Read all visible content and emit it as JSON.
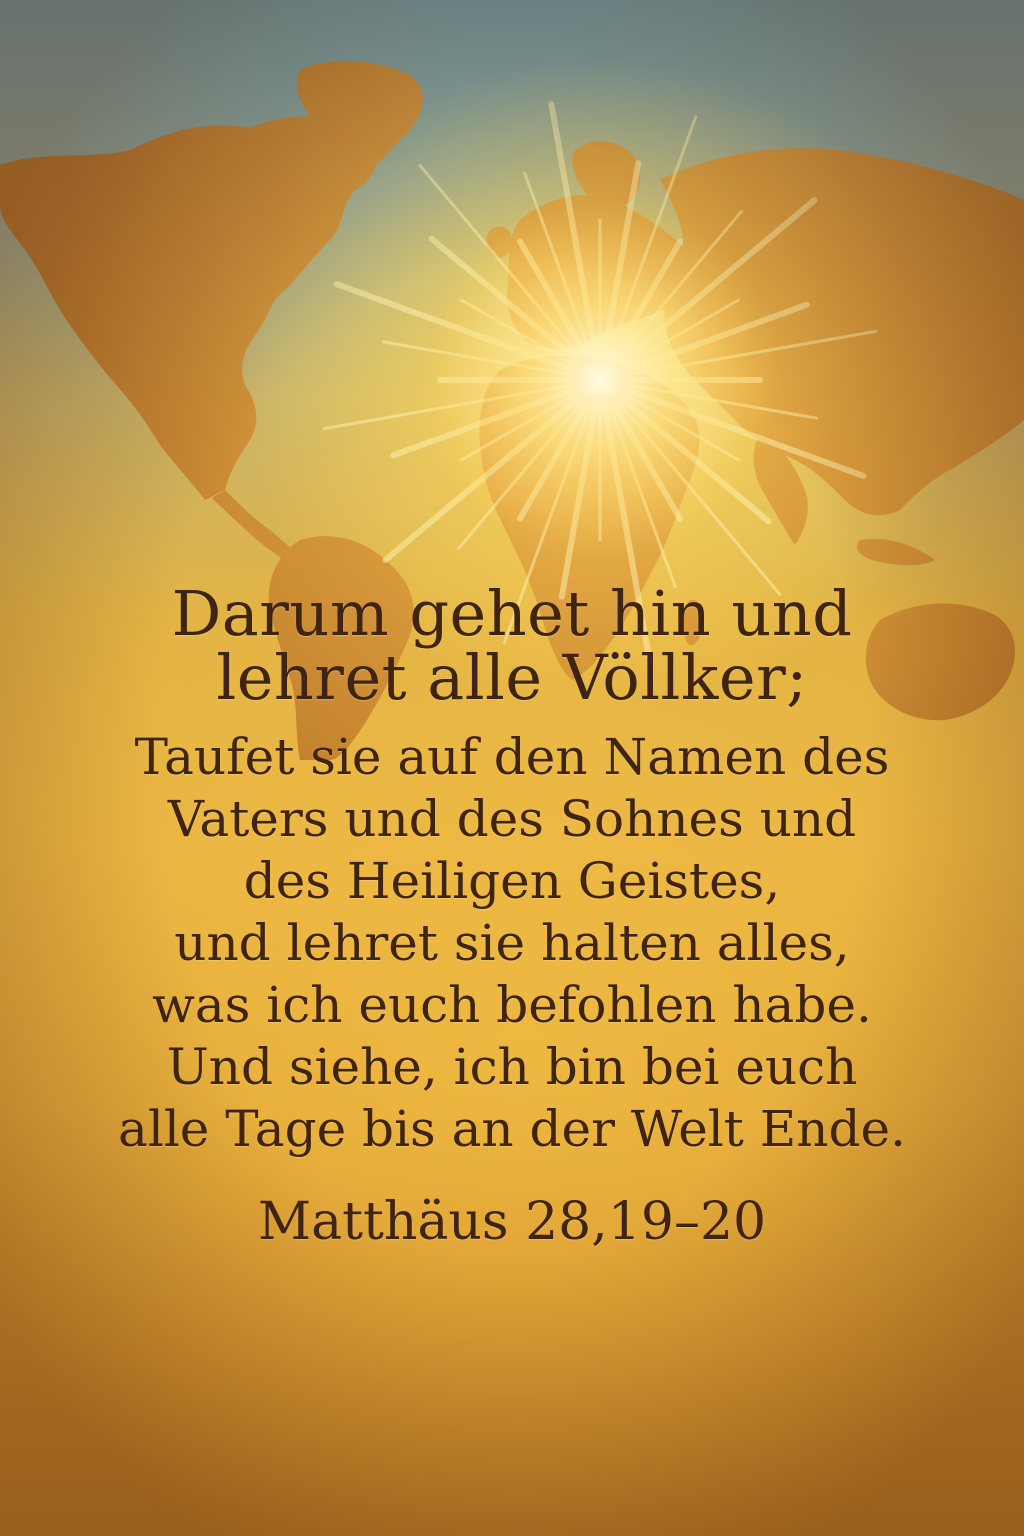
{
  "verse": {
    "headline": [
      "Darum gehet hin und",
      "lehret alle Völlker;"
    ],
    "body": [
      "Taufet sie auf den Namen des",
      "Vaters und des Sohnes und",
      "des Heiligen Geistes,",
      "und lehret sie halten alles,",
      "was ich euch befohlen habe.",
      "Und siehe, ich bin bei euch",
      "alle Tage bis an der Welt Ende."
    ],
    "reference": "Matthäus 28,19–20"
  },
  "colors": {
    "text": "#3f2412",
    "land": "#c9832f",
    "sky_top": "#6f9aa4",
    "glow": "#fff8be"
  }
}
